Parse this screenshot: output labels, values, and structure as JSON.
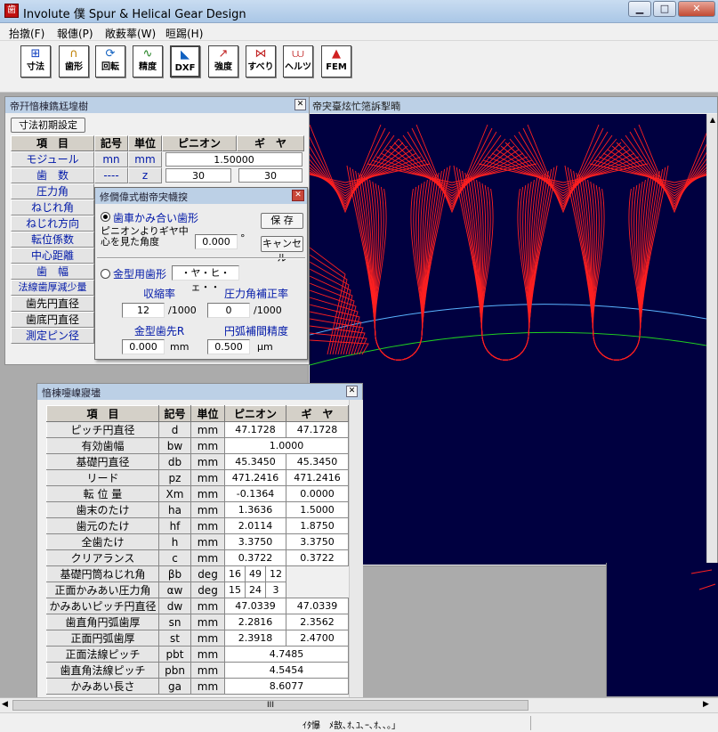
{
  "window": {
    "title": "Involute 僕 Spur & Helical Gear Design",
    "app_icon": "app-gear-icon",
    "btn_min": "0",
    "btn_max": "1",
    "btn_close": "r"
  },
  "menu": [
    "抬撴(F)",
    "報僡(P)",
    "敞薮蕐(W)",
    "晅踢(H)"
  ],
  "toolbar": [
    {
      "label": "寸法",
      "icon": "dimension-icon",
      "glyph": "⊞"
    },
    {
      "label": "歯形",
      "icon": "tooth-profile-icon",
      "glyph": "∩"
    },
    {
      "label": "回転",
      "icon": "rotate-icon",
      "glyph": "⟳"
    },
    {
      "label": "精度",
      "icon": "accuracy-icon",
      "glyph": "∿"
    },
    {
      "label": "DXF",
      "icon": "dxf-export-icon",
      "glyph": "◣"
    },
    {
      "label": "強度",
      "icon": "strength-icon",
      "glyph": "↗"
    },
    {
      "label": "すべり",
      "icon": "slip-icon",
      "glyph": "⋈"
    },
    {
      "label": "ヘルツ",
      "icon": "hertz-icon",
      "glyph": "⩊"
    },
    {
      "label": "FEM",
      "icon": "fem-icon",
      "glyph": "▲"
    }
  ],
  "plot": {
    "title": "帝宊臺炫忙筂訴揧暔",
    "bg": "#000040",
    "tooth_color": "#ff2020",
    "circle1": "#5ab4ff",
    "circle2": "#20d020"
  },
  "spec": {
    "title": "帝幵愔棟鐫尪堭樹",
    "init_button": "寸法初期設定",
    "headers": [
      "項　目",
      "記号",
      "単位",
      "ピニオン",
      "ギ　ヤ"
    ],
    "rows": [
      {
        "label": "モジュール",
        "symbol": "mn",
        "unit": "mm",
        "merged": "1.50000"
      },
      {
        "label": "歯　数",
        "symbol": "----",
        "unit": "z",
        "pinion": "30",
        "gear": "30"
      },
      {
        "label": "圧力角"
      },
      {
        "label": "ねじれ角"
      },
      {
        "label": "ねじれ方向"
      },
      {
        "label": "転位係数"
      },
      {
        "label": "中心距離"
      },
      {
        "label": "歯　幅"
      },
      {
        "label": "法線歯厚減少量"
      },
      {
        "label": "歯先円直径"
      },
      {
        "label": "歯底円直径"
      },
      {
        "label": "測定ピン径"
      }
    ]
  },
  "dialog": {
    "title": "修僩偉式樹帝宊幭揬",
    "opt1": "歯車かみ合い歯形",
    "angle_label": "ピニオンよりギヤ中心を見た角度",
    "angle_value": "0.000",
    "angle_unit": "°",
    "save": "保 存",
    "cancel": "キャンセル",
    "opt2": "金型用歯形",
    "opt2_field": "・ヤ・ヒ・ェ・・",
    "shrink_label": "収縮率",
    "shrink_value": "12",
    "shrink_unit": "/1000",
    "pa_corr_label": "圧力角補正率",
    "pa_corr_value": "0",
    "pa_corr_unit": "/1000",
    "tipr_label": "金型歯先R",
    "tipr_value": "0.000",
    "tipr_unit": "mm",
    "arc_label": "円弧補間精度",
    "arc_value": "0.500",
    "arc_unit": "μm"
  },
  "results": {
    "title": "愔棟嚏嵲寢壗",
    "headers": [
      "項　目",
      "記号",
      "単位",
      "ピニオン",
      "ギ　ヤ"
    ],
    "rows": [
      {
        "label": "ピッチ円直径",
        "sym": "d",
        "unit": "mm",
        "p": "47.1728",
        "g": "47.1728"
      },
      {
        "label": "有効歯幅",
        "sym": "bw",
        "unit": "mm",
        "m": "1.0000"
      },
      {
        "label": "基礎円直径",
        "sym": "db",
        "unit": "mm",
        "p": "45.3450",
        "g": "45.3450"
      },
      {
        "label": "リード",
        "sym": "pz",
        "unit": "mm",
        "p": "471.2416",
        "g": "471.2416"
      },
      {
        "label": "転 位 量",
        "sym": "Xm",
        "unit": "mm",
        "p": "-0.1364",
        "g": "0.0000"
      },
      {
        "label": "歯末のたけ",
        "sym": "ha",
        "unit": "mm",
        "p": "1.3636",
        "g": "1.5000"
      },
      {
        "label": "歯元のたけ",
        "sym": "hf",
        "unit": "mm",
        "p": "2.0114",
        "g": "1.8750"
      },
      {
        "label": "全歯たけ",
        "sym": "h",
        "unit": "mm",
        "p": "3.3750",
        "g": "3.3750"
      },
      {
        "label": "クリアランス",
        "sym": "c",
        "unit": "mm",
        "p": "0.3722",
        "g": "0.3722"
      },
      {
        "label": "基礎円筒ねじれ角",
        "sym": "βb",
        "unit": "deg",
        "deg": [
          "16",
          "49",
          "12"
        ]
      },
      {
        "label": "正面かみあい圧力角",
        "sym": "αw",
        "unit": "deg",
        "deg": [
          "15",
          "24",
          "3"
        ]
      },
      {
        "label": "かみあいピッチ円直径",
        "sym": "dw",
        "unit": "mm",
        "p": "47.0339",
        "g": "47.0339"
      },
      {
        "label": "歯直角円弧歯厚",
        "sym": "sn",
        "unit": "mm",
        "p": "2.2816",
        "g": "2.3562"
      },
      {
        "label": "正面円弧歯厚",
        "sym": "st",
        "unit": "mm",
        "p": "2.3918",
        "g": "2.4700"
      },
      {
        "label": "正面法線ピッチ",
        "sym": "pbt",
        "unit": "mm",
        "m": "4.7485"
      },
      {
        "label": "歯直角法線ピッチ",
        "sym": "pbn",
        "unit": "mm",
        "m": "4.5454"
      },
      {
        "label": "かみあい長さ",
        "sym": "ga",
        "unit": "mm",
        "m": "8.6077"
      }
    ]
  },
  "hscroll": {
    "thumb": "III"
  },
  "status": {
    "text": "ｲﾀ懪　ﾒ敨､ｵ､ﾕ､ｰ､ｵ､､｡｣"
  }
}
